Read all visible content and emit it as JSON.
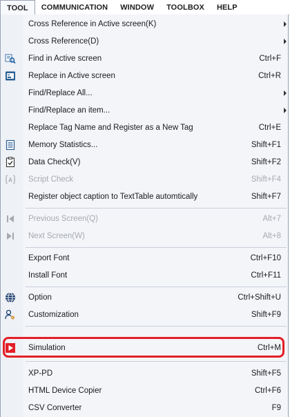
{
  "menubar": {
    "tabs": [
      "TOOL",
      "COMMUNICATION",
      "WINDOW",
      "TOOLBOX",
      "HELP"
    ]
  },
  "menu": {
    "items": [
      {
        "label": "Cross Reference in Active screen(K)",
        "shortcut": "",
        "icon": "",
        "submenu": true,
        "disabled": false
      },
      {
        "label": "Cross Reference(D)",
        "shortcut": "",
        "icon": "",
        "submenu": true,
        "disabled": false
      },
      {
        "label": "Find in Active screen",
        "shortcut": "Ctrl+F",
        "icon": "find-icon",
        "submenu": false,
        "disabled": false
      },
      {
        "label": "Replace in Active screen",
        "shortcut": "Ctrl+R",
        "icon": "replace-icon",
        "submenu": false,
        "disabled": false
      },
      {
        "label": "Find/Replace All...",
        "shortcut": "",
        "icon": "",
        "submenu": true,
        "disabled": false
      },
      {
        "label": "Find/Replace an item...",
        "shortcut": "",
        "icon": "",
        "submenu": true,
        "disabled": false
      },
      {
        "label": "Replace Tag Name and Register as a New Tag",
        "shortcut": "Ctrl+E",
        "icon": "",
        "submenu": false,
        "disabled": false
      },
      {
        "label": "Memory Statistics...",
        "shortcut": "Shift+F1",
        "icon": "memory-icon",
        "submenu": false,
        "disabled": false
      },
      {
        "label": "Data Check(V)",
        "shortcut": "Shift+F2",
        "icon": "checklist-icon",
        "submenu": false,
        "disabled": false
      },
      {
        "label": "Script Check",
        "shortcut": "Shift+F4",
        "icon": "script-check-icon",
        "submenu": false,
        "disabled": true
      },
      {
        "label": "Register object caption to TextTable automtically",
        "shortcut": "Shift+F7",
        "icon": "",
        "submenu": false,
        "disabled": false
      },
      {
        "label": "Previous Screen(Q)",
        "shortcut": "Alt+7",
        "icon": "previous-icon",
        "submenu": false,
        "disabled": true
      },
      {
        "label": "Next Screen(W)",
        "shortcut": "Alt+8",
        "icon": "next-icon",
        "submenu": false,
        "disabled": true
      },
      {
        "label": "Export Font",
        "shortcut": "Ctrl+F10",
        "icon": "",
        "submenu": false,
        "disabled": false
      },
      {
        "label": "Install Font",
        "shortcut": "Ctrl+F11",
        "icon": "",
        "submenu": false,
        "disabled": false
      },
      {
        "label": "Option",
        "shortcut": "Ctrl+Shift+U",
        "icon": "globe-icon",
        "submenu": false,
        "disabled": false
      },
      {
        "label": "Customization",
        "shortcut": "Shift+F9",
        "icon": "users-gear-icon",
        "submenu": false,
        "disabled": false
      },
      {
        "label": "Simulation",
        "shortcut": "Ctrl+M",
        "icon": "play-icon",
        "submenu": false,
        "disabled": false
      },
      {
        "label": "XP-PD",
        "shortcut": "Shift+F5",
        "icon": "",
        "submenu": false,
        "disabled": false
      },
      {
        "label": "HTML Device Copier",
        "shortcut": "Ctrl+F6",
        "icon": "",
        "submenu": false,
        "disabled": false
      },
      {
        "label": "CSV Converter",
        "shortcut": "F9",
        "icon": "",
        "submenu": false,
        "disabled": false
      }
    ]
  },
  "colors": {
    "highlight_border": "#e41e26",
    "simulation_icon": "#e41e26",
    "disabled_text": "#a6a9ae"
  }
}
